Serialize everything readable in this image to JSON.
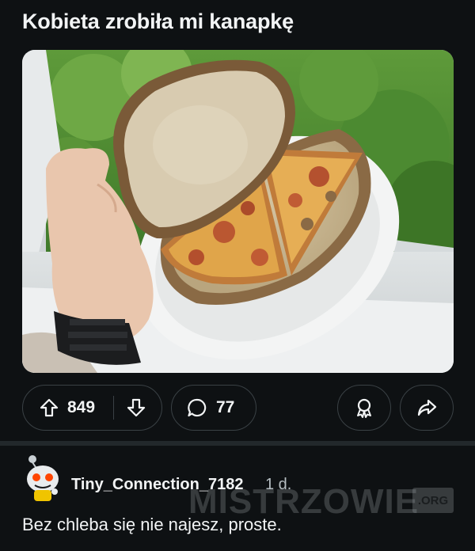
{
  "post": {
    "title": "Kobieta zrobiła mi kanapkę"
  },
  "actions": {
    "upvote_count": "849",
    "comment_count": "77"
  },
  "comment": {
    "username": "Tiny_Connection_7182",
    "timestamp": "1 d.",
    "body": "Bez chleba się nie najesz, proste."
  },
  "watermark": {
    "text": "MISTRZOWIE",
    "suffix": ".ORG"
  },
  "icons": {
    "upvote": "arrow-up-icon",
    "downvote": "arrow-down-icon",
    "comments": "speech-bubble-icon",
    "award": "award-icon",
    "share": "share-arrow-icon"
  },
  "colors": {
    "background": "#0e1113",
    "border": "#3a4145",
    "text": "#f2f4f5",
    "muted": "#b6bec2"
  }
}
